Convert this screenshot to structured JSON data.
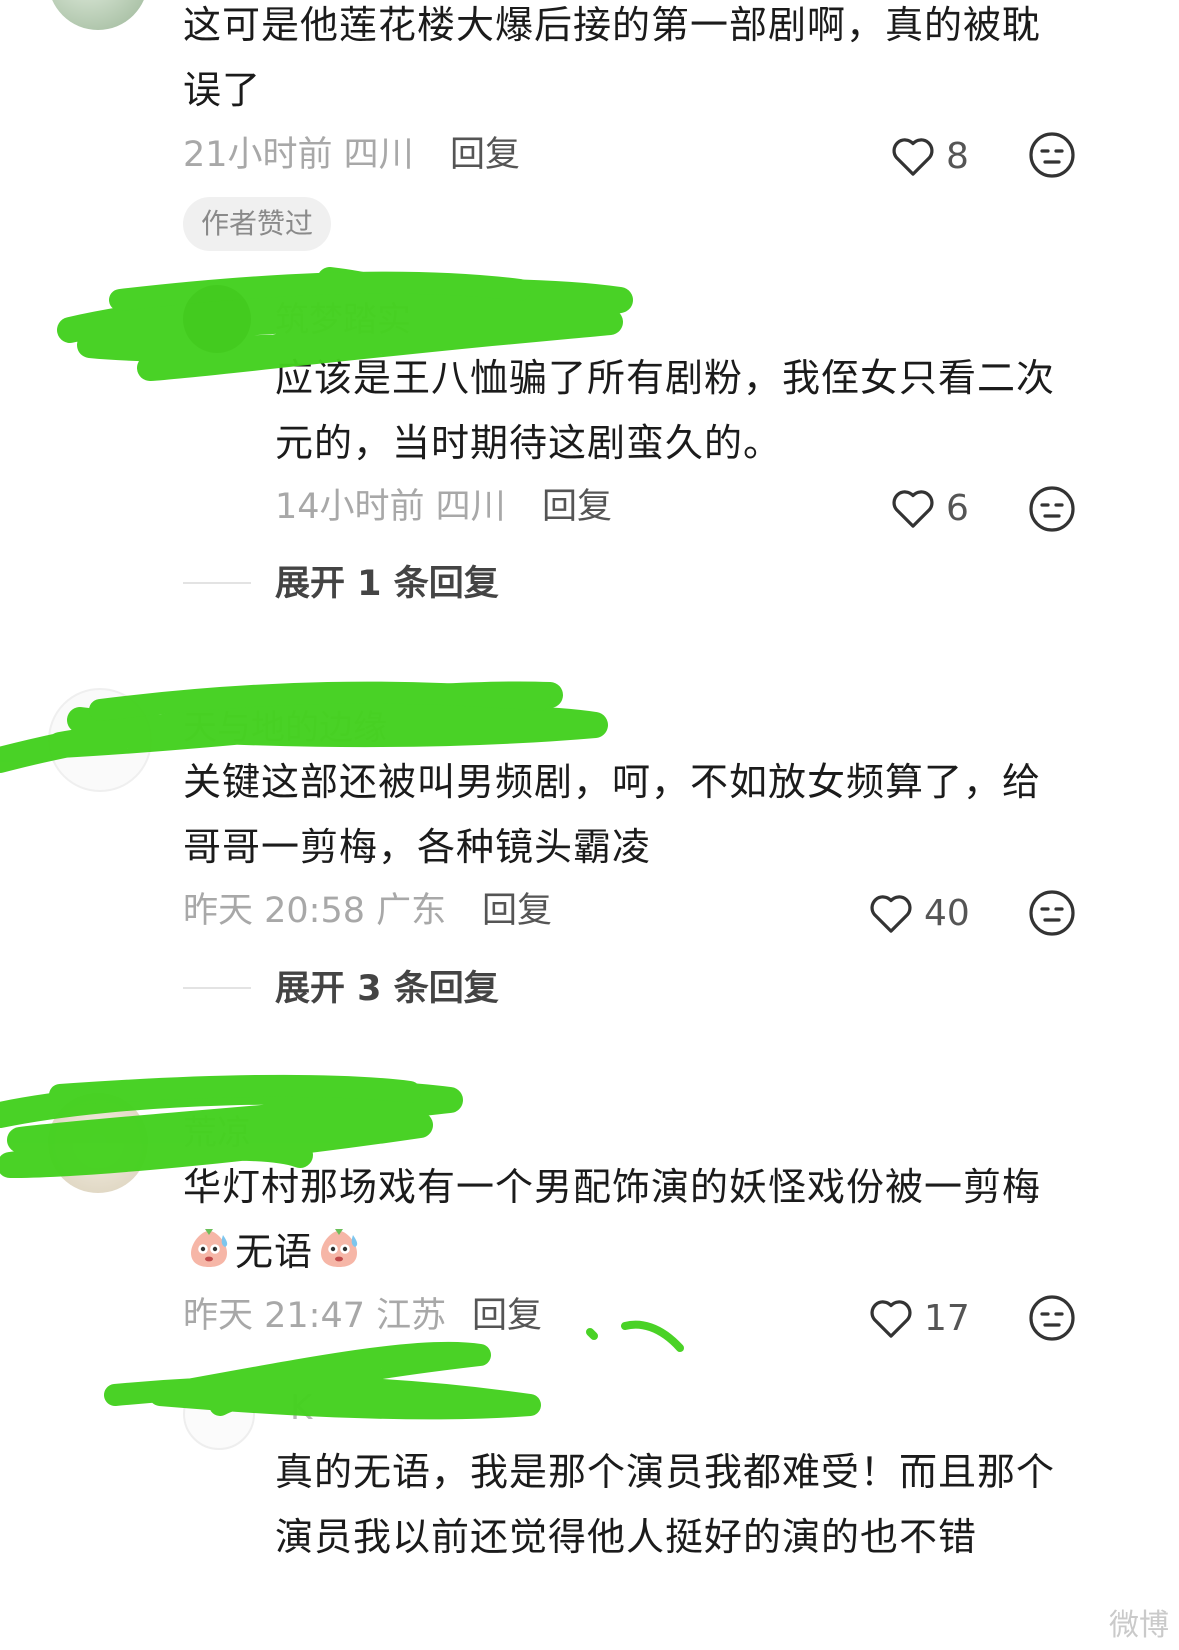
{
  "comments": [
    {
      "text": "这可是他莲花楼大爆后接的第一部剧啊，真的被耽误了",
      "meta": "21小时前 四川",
      "reply_label": "回复",
      "likes": "8",
      "badge": "作者赞过"
    },
    {
      "username": "筑梦踏实",
      "text": "应该是王八恤骗了所有剧粉，我侄女只看二次元的，当时期待这剧蛮久的。",
      "meta": "14小时前 四川",
      "reply_label": "回复",
      "likes": "6",
      "expand": "展开 1 条回复"
    },
    {
      "username": "天与地的边缘",
      "text": "关键这部还被叫男频剧，呵，不如放女频算了，给哥哥一剪梅，各种镜头霸凌",
      "meta": "昨天 20:58 广东",
      "reply_label": "回复",
      "likes": "40",
      "expand": "展开 3 条回复"
    },
    {
      "username": "荒凉",
      "text": "华灯村那场戏有一个男配饰演的妖怪戏份被一剪梅",
      "text_tail": "无语",
      "meta": "昨天 21:47 江苏",
      "reply_label": "回复",
      "likes": "17"
    },
    {
      "username": "K",
      "text": "真的无语，我是那个演员我都难受！而且那个演员我以前还觉得他人挺好的演的也不错"
    }
  ],
  "watermark": "微博",
  "colors": {
    "scribble": "#44d11f",
    "meta": "#a8a8a8"
  },
  "icons": [
    "heart-outline-icon",
    "emoji-face-icon",
    "sweat-emoji-icon"
  ]
}
